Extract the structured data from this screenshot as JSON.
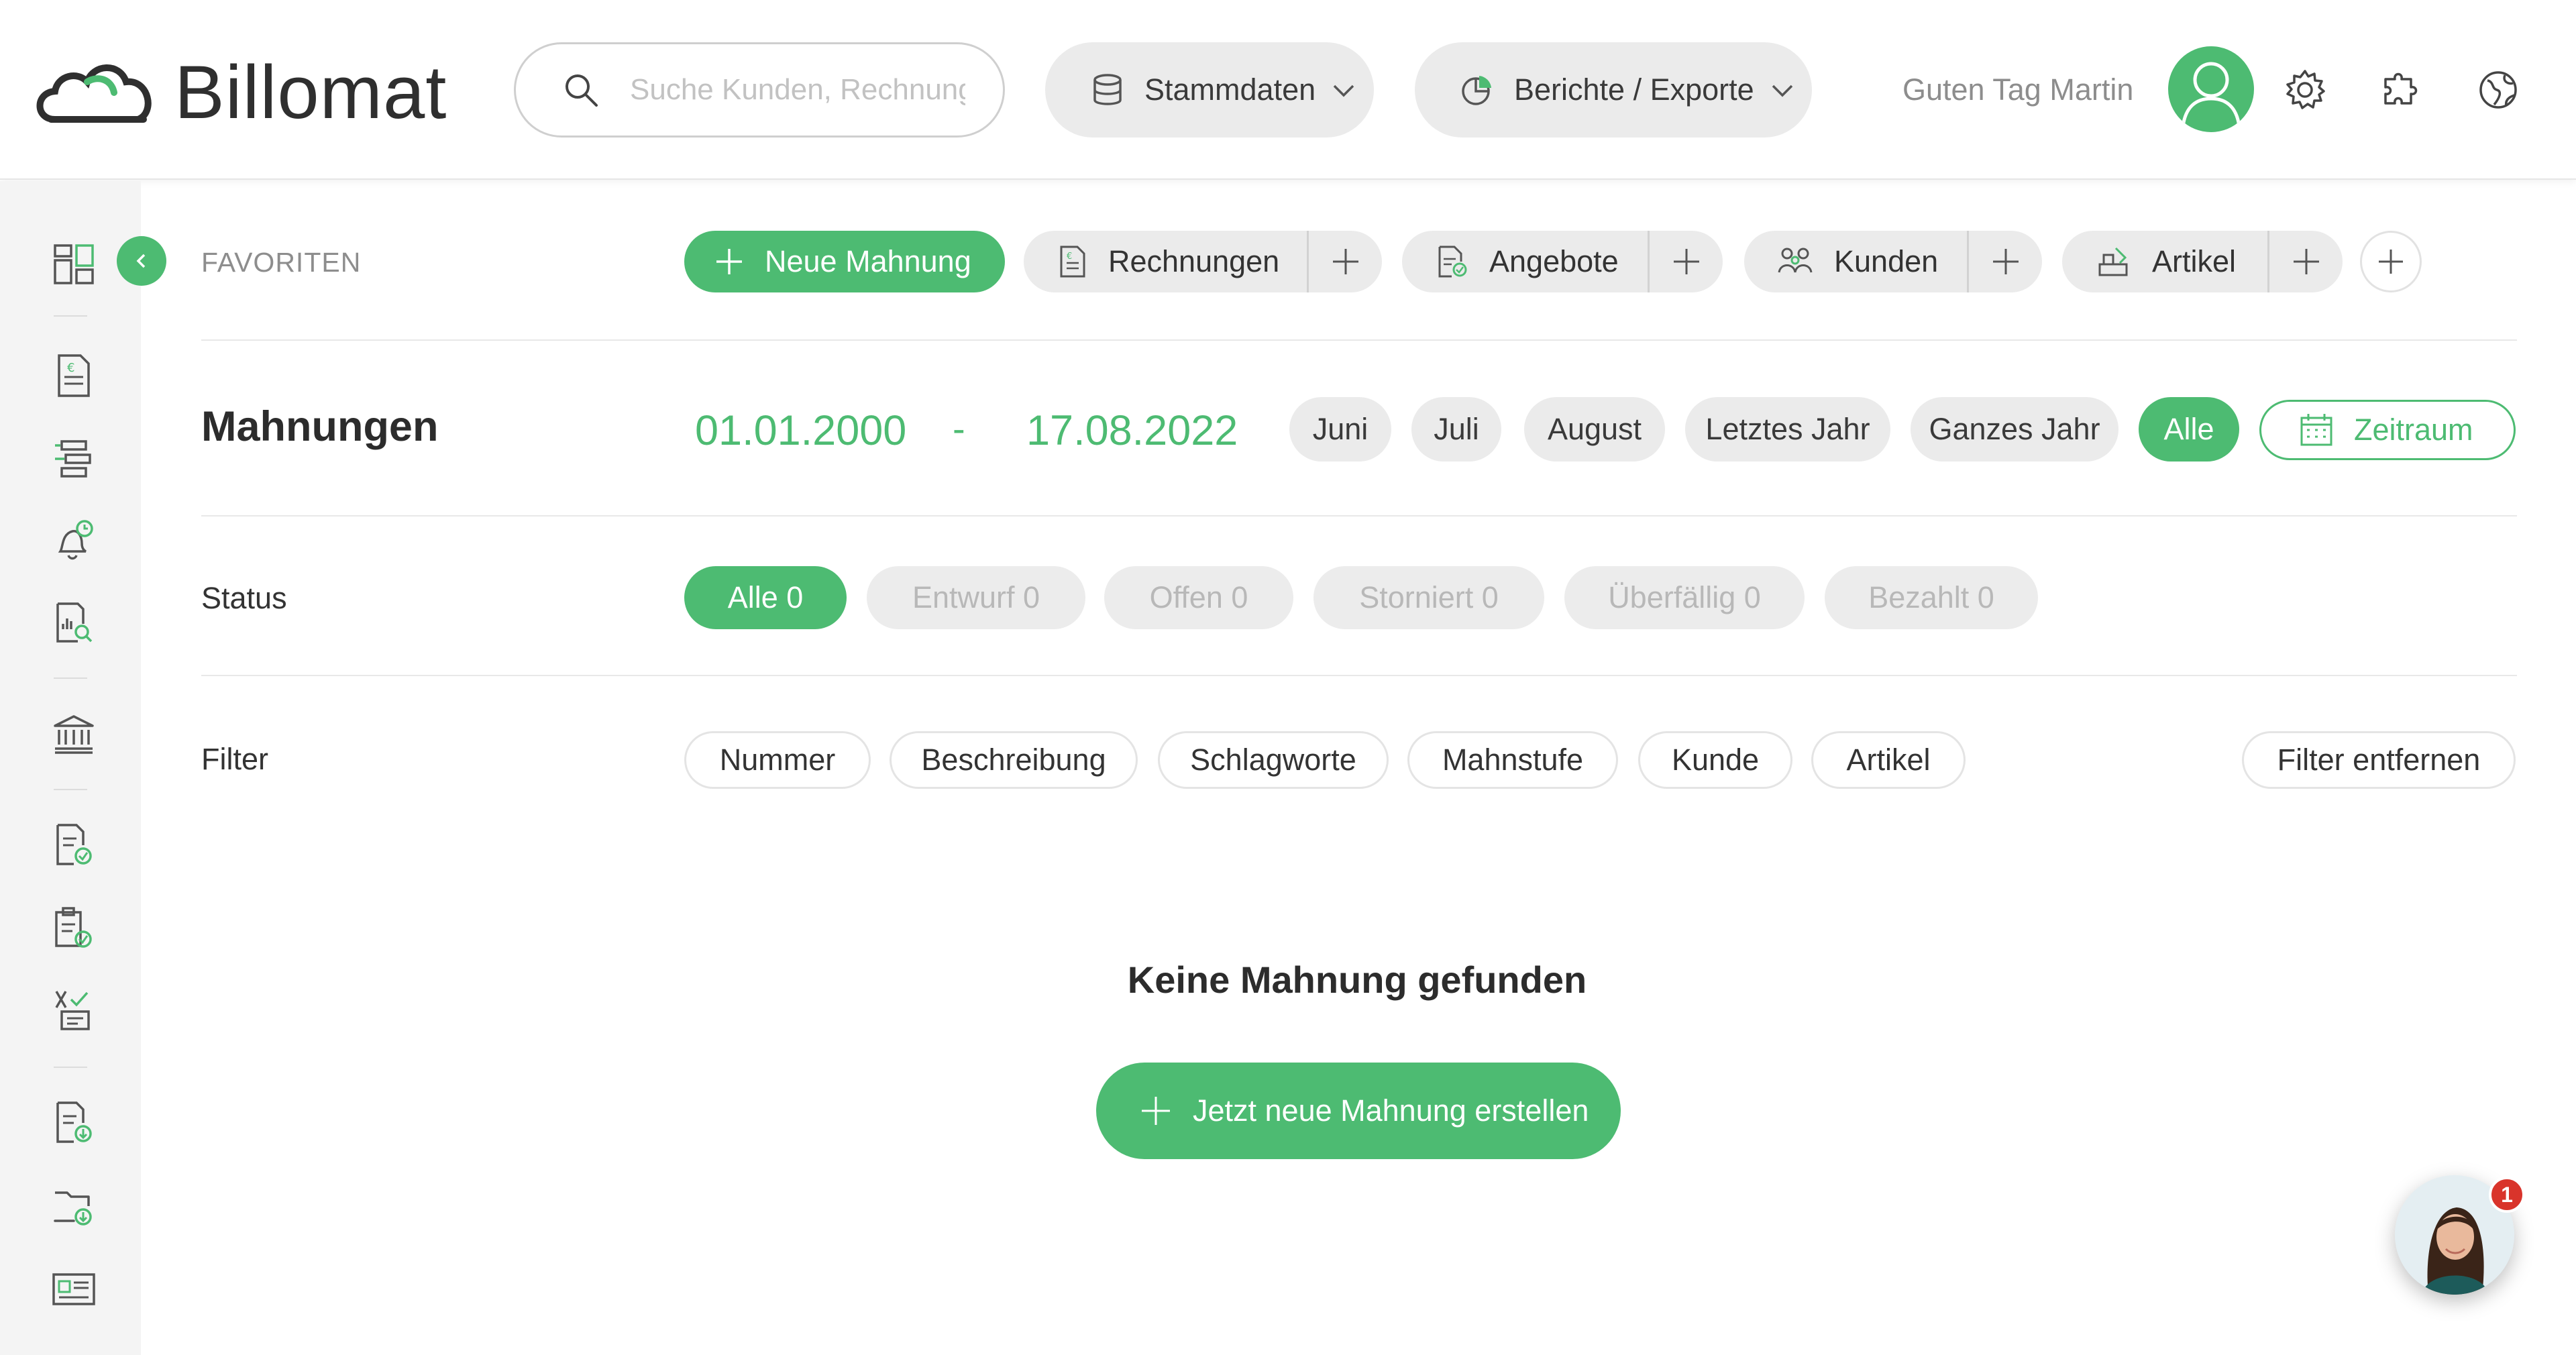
{
  "app": {
    "name": "Billomat"
  },
  "header": {
    "search_placeholder": "Suche Kunden, Rechnungen, ...",
    "nav": [
      {
        "label": "Stammdaten",
        "icon": "database-icon"
      },
      {
        "label": "Berichte / Exporte",
        "icon": "pie-chart-icon"
      }
    ],
    "greeting": "Guten Tag Martin",
    "icons": [
      "user-avatar",
      "gear-icon",
      "puzzle-icon",
      "globe-icon"
    ]
  },
  "sidebar": {
    "icons": [
      "dashboard-icon",
      "invoice-icon",
      "workflow-icon",
      "reminder-bell-icon",
      "report-search-icon",
      "bank-icon",
      "document-check-icon",
      "clipboard-check-icon",
      "tasks-icon",
      "document-download-icon",
      "folder-download-icon",
      "id-card-icon"
    ]
  },
  "favorites": {
    "label": "FAVORITEN",
    "primary": "Neue Mahnung",
    "items": [
      {
        "label": "Rechnungen",
        "icon": "invoice-icon"
      },
      {
        "label": "Angebote",
        "icon": "offer-icon"
      },
      {
        "label": "Kunden",
        "icon": "customers-icon"
      },
      {
        "label": "Artikel",
        "icon": "article-icon"
      }
    ]
  },
  "page": {
    "title": "Mahnungen",
    "date_from": "01.01.2000",
    "date_sep": "-",
    "date_to": "17.08.2022",
    "ranges": [
      "Juni",
      "Juli",
      "August",
      "Letztes Jahr",
      "Ganzes Jahr",
      "Alle"
    ],
    "active_range": "Alle",
    "custom_range": "Zeitraum"
  },
  "status": {
    "label": "Status",
    "items": [
      "Alle 0",
      "Entwurf 0",
      "Offen 0",
      "Storniert 0",
      "Überfällig 0",
      "Bezahlt 0"
    ],
    "active": "Alle 0"
  },
  "filter": {
    "label": "Filter",
    "items": [
      "Nummer",
      "Beschreibung",
      "Schlagworte",
      "Mahnstufe",
      "Kunde",
      "Artikel"
    ],
    "clear": "Filter entfernen"
  },
  "empty": {
    "title": "Keine Mahnung gefunden",
    "button": "Jetzt neue Mahnung erstellen"
  },
  "chat": {
    "badge": "1"
  },
  "colors": {
    "accent": "#4dbb72",
    "pill": "#ebebeb",
    "badge": "#d9342b"
  }
}
